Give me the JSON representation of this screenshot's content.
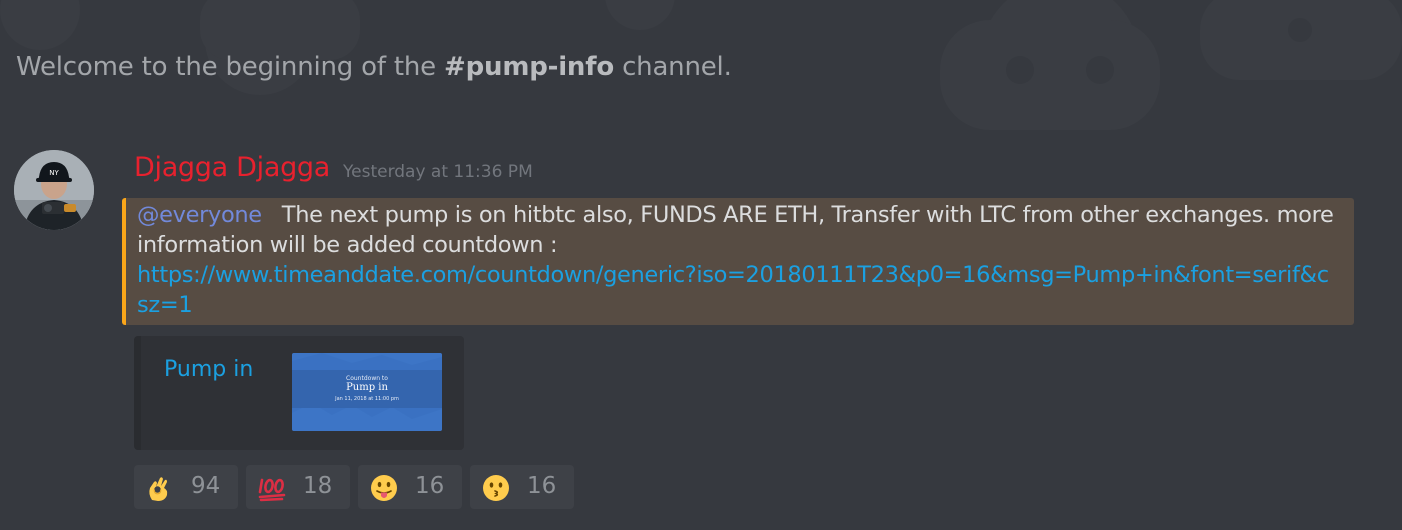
{
  "channel": {
    "welcome_prefix": "Welcome to the beginning of the ",
    "name": "#pump-info",
    "welcome_suffix": " channel."
  },
  "message": {
    "author": "Djagga Djagga",
    "author_color": "#e8212e",
    "timestamp": "Yesterday at 11:36 PM",
    "mention": "@everyone",
    "text": "The next pump is on hitbtc also, FUNDS ARE ETH, Transfer with LTC from other exchanges. more information will be added countdown :",
    "link": "https://www.timeanddate.com/countdown/generic?iso=20180111T23&p0=16&msg=Pump+in&font=serif&csz=1",
    "highlight_color": "#574c43",
    "highlight_border_color": "#faa61a"
  },
  "embed": {
    "title": "Pump in",
    "thumbnail": {
      "line1": "Countdown to",
      "line2": "Pump in",
      "line3": "Jan 11, 2018 at 11:00 pm"
    }
  },
  "reactions": [
    {
      "emoji": "ok-hand-emoji",
      "count": "94"
    },
    {
      "emoji": "hundred-points-emoji",
      "count": "18"
    },
    {
      "emoji": "tongue-face-emoji",
      "count": "16"
    },
    {
      "emoji": "kissing-face-emoji",
      "count": "16"
    }
  ]
}
